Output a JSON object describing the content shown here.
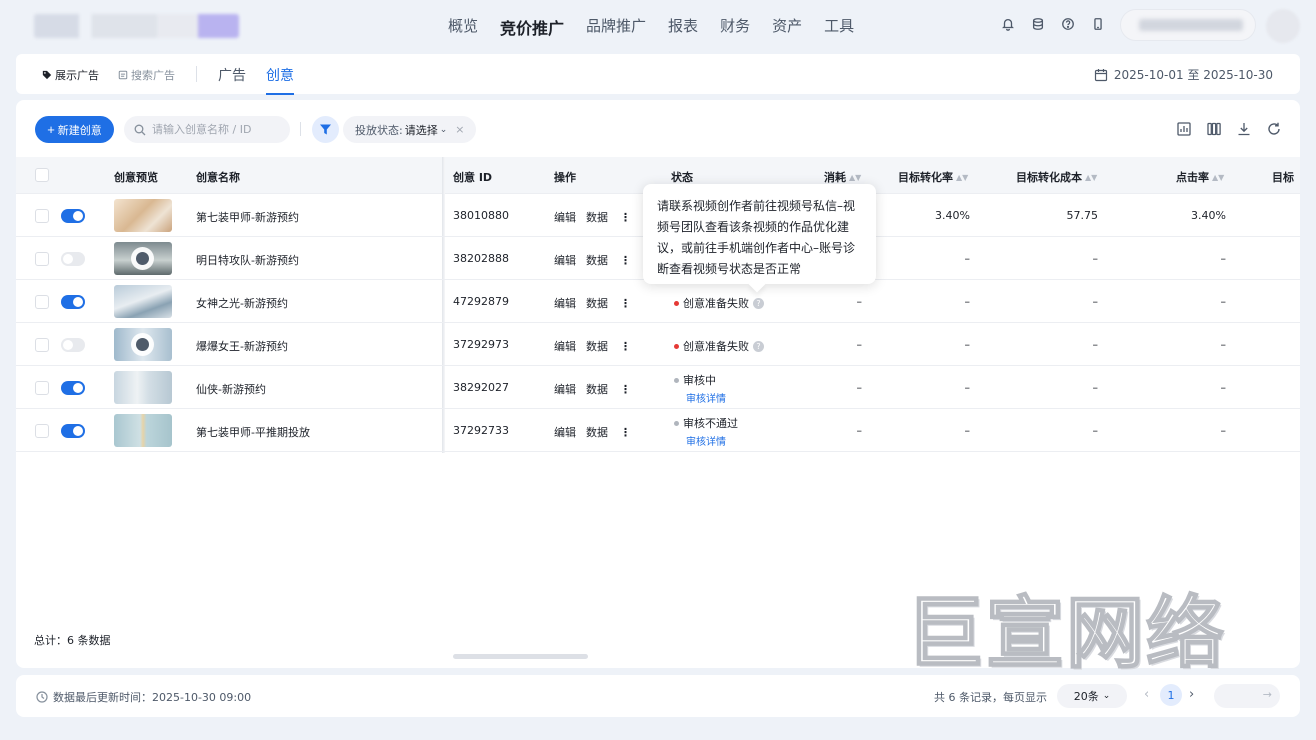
{
  "topnav": {
    "items": [
      "概览",
      "竞价推广",
      "品牌推广",
      "报表",
      "财务",
      "资产",
      "工具"
    ],
    "active_index": 1
  },
  "subheader": {
    "ad_types": [
      "展示广告",
      "搜索广告"
    ],
    "view_tabs": [
      "广告",
      "创意"
    ],
    "active_view": "创意",
    "date_range": "2025-10-01 至 2025-10-30"
  },
  "toolbar": {
    "new_button": "新建创意",
    "search_placeholder": "请输入创意名称 / ID",
    "filter_label": "投放状态:",
    "filter_value": "请选择"
  },
  "table": {
    "columns": [
      "创意预览",
      "创意名称",
      "创意 ID",
      "操作",
      "状态",
      "消耗",
      "目标转化率",
      "目标转化成本",
      "点击率",
      "目标"
    ],
    "edit_label": "编辑",
    "data_label": "数据",
    "review_detail_label": "审核详情",
    "rows": [
      {
        "enabled": true,
        "name": "第七装甲师-新游预约",
        "id": "38010880",
        "status": "",
        "cost": "",
        "conv_rate": "3.40%",
        "conv_cost": "57.75",
        "ctr": "3.40%"
      },
      {
        "enabled": false,
        "name": "明日特攻队-新游预约",
        "id": "38202888",
        "status": "",
        "cost": "",
        "conv_rate": "–",
        "conv_cost": "–",
        "ctr": "–"
      },
      {
        "enabled": true,
        "name": "女神之光-新游预约",
        "id": "47292879",
        "status": "创意准备失败",
        "cost": "–",
        "conv_rate": "–",
        "conv_cost": "–",
        "ctr": "–"
      },
      {
        "enabled": false,
        "name": "爆爆女王-新游预约",
        "id": "37292973",
        "status": "创意准备失败",
        "cost": "–",
        "conv_rate": "–",
        "conv_cost": "–",
        "ctr": "–"
      },
      {
        "enabled": true,
        "name": "仙侠-新游预约",
        "id": "38292027",
        "status": "审核中",
        "cost": "–",
        "conv_rate": "–",
        "conv_cost": "–",
        "ctr": "–"
      },
      {
        "enabled": true,
        "name": "第七装甲师-平推期投放",
        "id": "37292733",
        "status": "审核不通过",
        "cost": "–",
        "conv_rate": "–",
        "conv_cost": "–",
        "ctr": "–"
      }
    ],
    "tooltip": "请联系视频创作者前往视频号私信–视频号团队查看该条视频的作品优化建议，或前往手机端创作者中心–账号诊断查看视频号状态是否正常",
    "total": "总计：6 条数据"
  },
  "footer": {
    "update_time": "数据最后更新时间：2025-10-30 09:00",
    "record_info": "共 6 条记录，每页显示",
    "page_size": "20条",
    "current_page": "1"
  },
  "watermark": "巨宣网络",
  "colors": {
    "accent": "#1f6fe5",
    "error": "#e53935",
    "background": "#eef2f8"
  }
}
